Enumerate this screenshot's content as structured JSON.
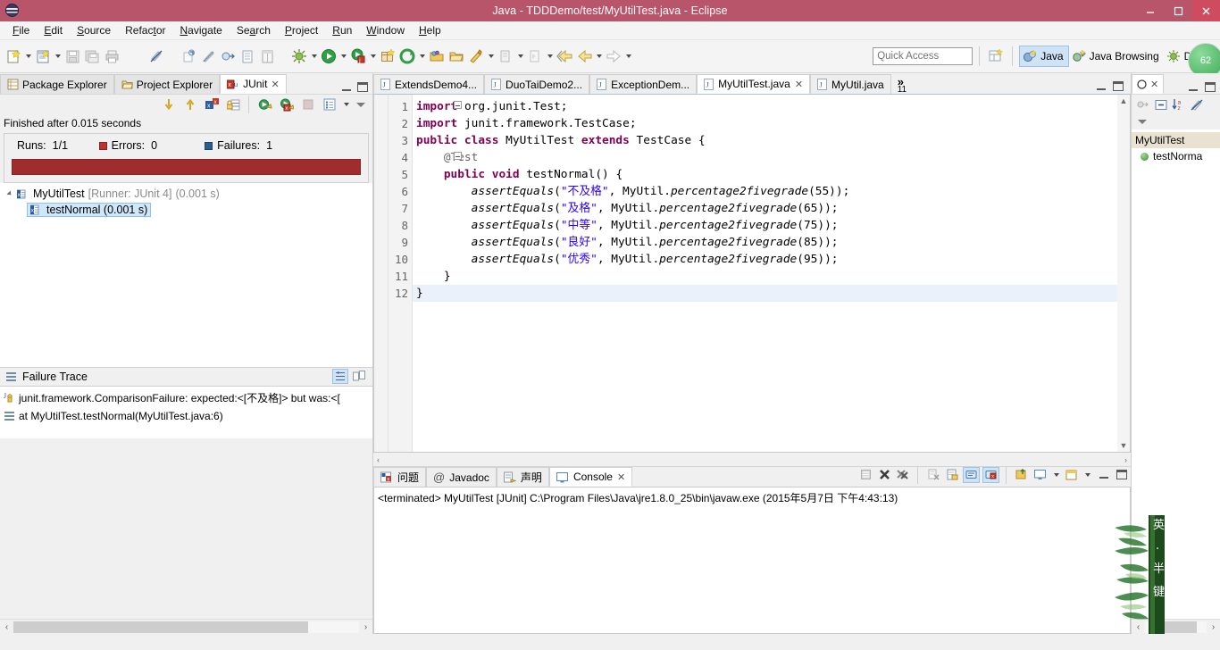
{
  "window": {
    "title": "Java - TDDDemo/test/MyUtilTest.java - Eclipse",
    "minimize": "–",
    "maximize": "❐",
    "close": "✕",
    "titlebar_color": "#b9556b",
    "close_color": "#cf4b5f"
  },
  "menubar": {
    "items": [
      {
        "label": "File",
        "mnemonic": "F"
      },
      {
        "label": "Edit",
        "mnemonic": "E"
      },
      {
        "label": "Source",
        "mnemonic": "S"
      },
      {
        "label": "Refactor",
        "mnemonic": "t"
      },
      {
        "label": "Navigate",
        "mnemonic": "N"
      },
      {
        "label": "Search",
        "mnemonic": "a"
      },
      {
        "label": "Project",
        "mnemonic": "P"
      },
      {
        "label": "Run",
        "mnemonic": "R"
      },
      {
        "label": "Window",
        "mnemonic": "W"
      },
      {
        "label": "Help",
        "mnemonic": "H"
      }
    ]
  },
  "toolbar": {
    "icons": [
      "new-wizard-icon",
      "new-java-class-icon",
      "save-icon",
      "save-all-icon",
      "print-icon",
      "toggle-mark-occurrences-icon",
      "new-annotation-icon",
      "skip-breakpoints-icon",
      "open-type-icon",
      "open-task-icon",
      "external-tools-icon",
      "debug-icon",
      "run-icon",
      "run-coverage-icon",
      "new-package-icon",
      "refresh-icon",
      "open-folder-icon",
      "open-resource-icon",
      "run-ant-icon",
      "next-edit-icon",
      "previous-edit-icon",
      "back-history-icon",
      "forward-history-icon"
    ],
    "quick_access_placeholder": "Quick Access",
    "perspective_switch_icon": "open-perspective-icon",
    "perspectives": [
      {
        "label": "Java",
        "icon": "java-perspective-icon",
        "active": true
      },
      {
        "label": "Java Browsing",
        "icon": "java-browsing-perspective-icon",
        "active": false
      },
      {
        "label": "Debug",
        "icon": "debug-perspective-icon",
        "active": false
      }
    ],
    "badge_text": "62"
  },
  "left_panel": {
    "tabs": [
      {
        "label": "Package Explorer",
        "icon": "package-explorer-icon",
        "active": false,
        "closable": false
      },
      {
        "label": "Project Explorer",
        "icon": "project-explorer-icon",
        "active": false,
        "closable": false
      },
      {
        "label": "JUnit",
        "icon": "junit-icon",
        "active": true,
        "closable": true
      }
    ],
    "view_toolbar_icons": [
      "next-failure-icon",
      "previous-failure-icon",
      "show-failures-only-icon",
      "lock-scroll-icon",
      "rerun-test-icon",
      "rerun-failed-tests-icon",
      "stop-icon",
      "test-history-icon",
      "view-menu-icon",
      "minimize-view-icon"
    ],
    "junit": {
      "status_text": "Finished after 0.015 seconds",
      "runs_label": "Runs:",
      "runs_value": "1/1",
      "errors_label": "Errors:",
      "errors_value": "0",
      "failures_label": "Failures:",
      "failures_value": "1",
      "progress_color": "#a02d2d",
      "tree": [
        {
          "name": "MyUtilTest",
          "runner": "[Runner: JUnit 4]",
          "time": "(0.001 s)",
          "icon": "test-class-failed-icon",
          "expanded": true,
          "selected": false,
          "children": [
            {
              "name": "testNormal (0.001 s)",
              "icon": "test-method-failed-icon",
              "selected": true
            }
          ]
        }
      ]
    },
    "failure_trace": {
      "title": "Failure Trace",
      "icon": "failure-trace-icon",
      "buttons": [
        "filter-stack-trace-icon",
        "compare-result-icon"
      ],
      "rows": [
        {
          "icon": "exception-icon",
          "text": "junit.framework.ComparisonFailure: expected:<[不及格]> but was:<["
        },
        {
          "icon": "stack-frame-icon",
          "text": "at MyUtilTest.testNormal(MyUtilTest.java:6)"
        }
      ]
    },
    "scrollbar": {
      "left_arrow": "‹",
      "right_arrow": "›"
    }
  },
  "editor": {
    "tabs": [
      {
        "label": "ExtendsDemo4...",
        "icon": "java-file-icon",
        "active": false,
        "closable": false
      },
      {
        "label": "DuoTaiDemo2...",
        "icon": "java-file-icon",
        "active": false,
        "closable": false
      },
      {
        "label": "ExceptionDem...",
        "icon": "java-file-icon",
        "active": false,
        "closable": false
      },
      {
        "label": "MyUtilTest.java",
        "icon": "java-file-icon",
        "active": true,
        "closable": true
      },
      {
        "label": "MyUtil.java",
        "icon": "java-file-icon",
        "active": false,
        "closable": false
      }
    ],
    "overflow_chevron": "»",
    "overflow_count": "11",
    "minimize_icon": "minimize-editor-icon",
    "maximize_icon": "maximize-editor-icon",
    "code_lines": [
      {
        "num": "1",
        "fold": true,
        "indent": 0,
        "segments": [
          {
            "t": "import",
            "c": "kw"
          },
          {
            "t": " org.junit.Test;",
            "c": ""
          }
        ]
      },
      {
        "num": "2",
        "fold": false,
        "indent": 0,
        "segments": [
          {
            "t": "import",
            "c": "kw"
          },
          {
            "t": " junit.framework.TestCase;",
            "c": ""
          }
        ]
      },
      {
        "num": "3",
        "fold": false,
        "indent": 0,
        "segments": [
          {
            "t": "public class",
            "c": "kw"
          },
          {
            "t": " MyUtilTest ",
            "c": ""
          },
          {
            "t": "extends",
            "c": "kw"
          },
          {
            "t": " TestCase {",
            "c": ""
          }
        ]
      },
      {
        "num": "4",
        "fold": true,
        "indent": 1,
        "segments": [
          {
            "t": "    @Test",
            "c": "ann"
          }
        ]
      },
      {
        "num": "5",
        "fold": false,
        "indent": 1,
        "segments": [
          {
            "t": "    ",
            "c": ""
          },
          {
            "t": "public void",
            "c": "kw"
          },
          {
            "t": " testNormal() {",
            "c": ""
          }
        ]
      },
      {
        "num": "6",
        "fold": false,
        "indent": 2,
        "segments": [
          {
            "t": "        ",
            "c": ""
          },
          {
            "t": "assertEquals",
            "c": "mth"
          },
          {
            "t": "(",
            "c": ""
          },
          {
            "t": "\"不及格\"",
            "c": "str"
          },
          {
            "t": ", MyUtil.",
            "c": ""
          },
          {
            "t": "percentage2fivegrade",
            "c": "mth"
          },
          {
            "t": "(55));",
            "c": ""
          }
        ]
      },
      {
        "num": "7",
        "fold": false,
        "indent": 2,
        "segments": [
          {
            "t": "        ",
            "c": ""
          },
          {
            "t": "assertEquals",
            "c": "mth"
          },
          {
            "t": "(",
            "c": ""
          },
          {
            "t": "\"及格\"",
            "c": "str"
          },
          {
            "t": ", MyUtil.",
            "c": ""
          },
          {
            "t": "percentage2fivegrade",
            "c": "mth"
          },
          {
            "t": "(65));",
            "c": ""
          }
        ]
      },
      {
        "num": "8",
        "fold": false,
        "indent": 2,
        "segments": [
          {
            "t": "        ",
            "c": ""
          },
          {
            "t": "assertEquals",
            "c": "mth"
          },
          {
            "t": "(",
            "c": ""
          },
          {
            "t": "\"中等\"",
            "c": "str"
          },
          {
            "t": ", MyUtil.",
            "c": ""
          },
          {
            "t": "percentage2fivegrade",
            "c": "mth"
          },
          {
            "t": "(75));",
            "c": ""
          }
        ]
      },
      {
        "num": "9",
        "fold": false,
        "indent": 2,
        "segments": [
          {
            "t": "        ",
            "c": ""
          },
          {
            "t": "assertEquals",
            "c": "mth"
          },
          {
            "t": "(",
            "c": ""
          },
          {
            "t": "\"良好\"",
            "c": "str"
          },
          {
            "t": ", MyUtil.",
            "c": ""
          },
          {
            "t": "percentage2fivegrade",
            "c": "mth"
          },
          {
            "t": "(85));",
            "c": ""
          }
        ]
      },
      {
        "num": "10",
        "fold": false,
        "indent": 2,
        "segments": [
          {
            "t": "        ",
            "c": ""
          },
          {
            "t": "assertEquals",
            "c": "mth"
          },
          {
            "t": "(",
            "c": ""
          },
          {
            "t": "\"优秀\"",
            "c": "str"
          },
          {
            "t": ", MyUtil.",
            "c": ""
          },
          {
            "t": "percentage2fivegrade",
            "c": "mth"
          },
          {
            "t": "(95));",
            "c": ""
          }
        ]
      },
      {
        "num": "11",
        "fold": false,
        "indent": 1,
        "segments": [
          {
            "t": "    }",
            "c": ""
          }
        ]
      },
      {
        "num": "12",
        "fold": false,
        "indent": 0,
        "highlight": true,
        "segments": [
          {
            "t": "}",
            "c": ""
          }
        ]
      }
    ]
  },
  "console_panel": {
    "tabs": [
      {
        "label": "问题",
        "icon": "problems-icon",
        "active": false,
        "closable": false
      },
      {
        "label": "Javadoc",
        "icon": "javadoc-icon",
        "active": false,
        "closable": false
      },
      {
        "label": "声明",
        "icon": "declaration-icon",
        "active": false,
        "closable": false
      },
      {
        "label": "Console",
        "icon": "console-icon",
        "active": true,
        "closable": true
      }
    ],
    "toolbar_icons": [
      "clear-console-icon",
      "terminate-icon",
      "remove-launch-icon",
      "remove-all-terminated-icon",
      "show-console-when-output-icon",
      "scroll-lock-icon",
      "word-wrap-icon",
      "pin-console-icon",
      "display-selected-console-icon",
      "open-console-icon",
      "minimize-console-icon",
      "maximize-console-icon"
    ],
    "content": "<terminated> MyUtilTest [JUnit] C:\\Program Files\\Java\\jre1.8.0_25\\bin\\javaw.exe (2015年5月7日 下午4:43:13)"
  },
  "outline": {
    "tab_label": "O",
    "tab_icon": "outline-icon",
    "toolbar_icons": [
      "sort-icon",
      "collapse-all-icon",
      "sort-az-icon",
      "hide-fields-icon",
      "view-menu-icon"
    ],
    "nodes": [
      {
        "label": "MyUtilTest",
        "icon": "class-icon",
        "selected": true,
        "indent": 0
      },
      {
        "label": "testNorma",
        "icon": "method-public-icon",
        "selected": false,
        "indent": 1
      }
    ]
  },
  "watermark": {
    "characters": [
      "英",
      "",
      "半",
      "键"
    ],
    "description": "bamboo-watermark"
  }
}
